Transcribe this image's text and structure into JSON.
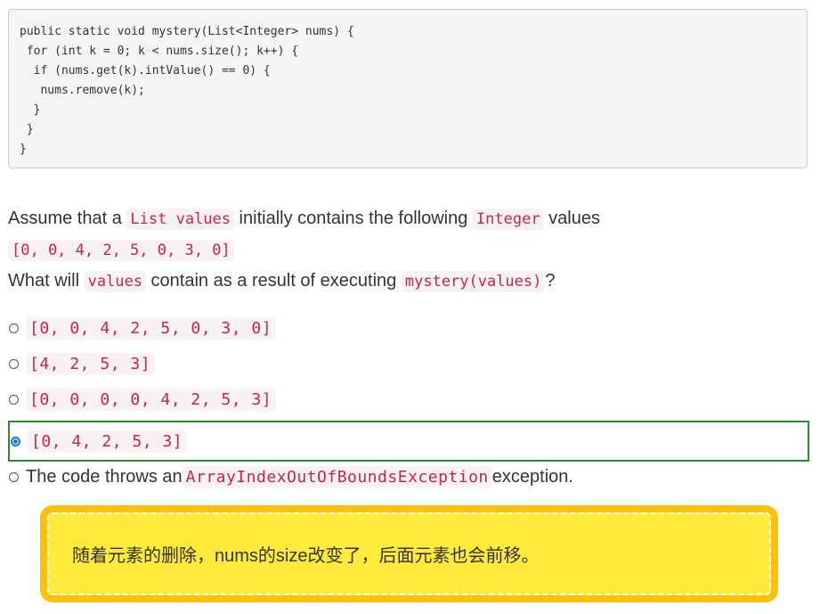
{
  "code": {
    "lines": [
      "public static void mystery(List<Integer> nums) {",
      " for (int k = 0; k < nums.size(); k++) {",
      "  if (nums.get(k).intValue() == 0) {",
      "   nums.remove(k);",
      "  }",
      " }",
      "}"
    ]
  },
  "question": {
    "line1_a": "Assume that a ",
    "line1_code1": "List values",
    "line1_b": " initially contains the following ",
    "line1_code2": "Integer",
    "line1_c": " values",
    "line2_code": "[0, 0, 4, 2, 5, 0, 3, 0]",
    "line3_a": "What will ",
    "line3_code1": "values",
    "line3_b": " contain as a result of executing ",
    "line3_code2": "mystery(values)",
    "line3_c": "?"
  },
  "options": [
    {
      "code": "[0, 0, 4, 2, 5, 0, 3, 0]",
      "selected": false
    },
    {
      "code": "[4, 2, 5, 3]",
      "selected": false
    },
    {
      "code": "[0, 0, 0, 0, 4, 2, 5, 3]",
      "selected": false
    },
    {
      "code": "[0, 4, 2, 5, 3]",
      "selected": true
    },
    {
      "text_a": "The code throws an ",
      "code": "ArrayIndexOutOfBoundsException",
      "text_b": " exception.",
      "selected": false
    }
  ],
  "note": {
    "text": "随着元素的删除，nums的size改变了，后面元素也会前移。"
  },
  "colors": {
    "selected_border": "#2e8b2e",
    "radio_checked": "#1a73e8",
    "note_outer": "#ffc107",
    "note_inner": "#ffeb3b",
    "inline_code": "#c7254e"
  }
}
